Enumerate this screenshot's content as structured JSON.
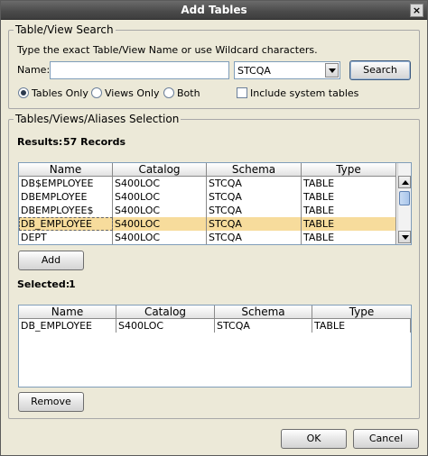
{
  "window": {
    "title": "Add Tables"
  },
  "search": {
    "legend": "Table/View Search",
    "instructions": "Type the exact Table/View Name or use Wildcard characters.",
    "name_label": "Name:",
    "name_value": "",
    "schema_value": "STCQA",
    "search_button": "Search",
    "radio_tables": "Tables Only",
    "radio_views": "Views Only",
    "radio_both": "Both",
    "selected_radio": "Tables Only",
    "include_system_label": "Include system tables",
    "include_system_checked": false
  },
  "selection": {
    "legend": "Tables/Views/Aliases Selection",
    "results_label": "Results:",
    "results_count": "57 Records",
    "columns": [
      "Name",
      "Catalog",
      "Schema",
      "Type"
    ],
    "rows": [
      [
        "DB$EMPLOYEE",
        "S400LOC",
        "STCQA",
        "TABLE"
      ],
      [
        "DBEMPLOYEE",
        "S400LOC",
        "STCQA",
        "TABLE"
      ],
      [
        "DBEMPLOYEE$",
        "S400LOC",
        "STCQA",
        "TABLE"
      ],
      [
        "DB_EMPLOYEE",
        "S400LOC",
        "STCQA",
        "TABLE"
      ],
      [
        "DEPT",
        "S400LOC",
        "STCQA",
        "TABLE"
      ]
    ],
    "selected_row_index": 3,
    "add_button": "Add",
    "selected_label": "Selected:",
    "selected_count": "1",
    "selected_columns": [
      "Name",
      "Catalog",
      "Schema",
      "Type"
    ],
    "selected_rows": [
      [
        "DB_EMPLOYEE",
        "S400LOC",
        "STCQA",
        "TABLE"
      ]
    ],
    "remove_button": "Remove"
  },
  "footer": {
    "ok_button": "OK",
    "cancel_button": "Cancel"
  },
  "colors": {
    "selected_row": "#f7dc9c",
    "titlebar": "#4a4a4a",
    "background": "#ECE9D8"
  }
}
